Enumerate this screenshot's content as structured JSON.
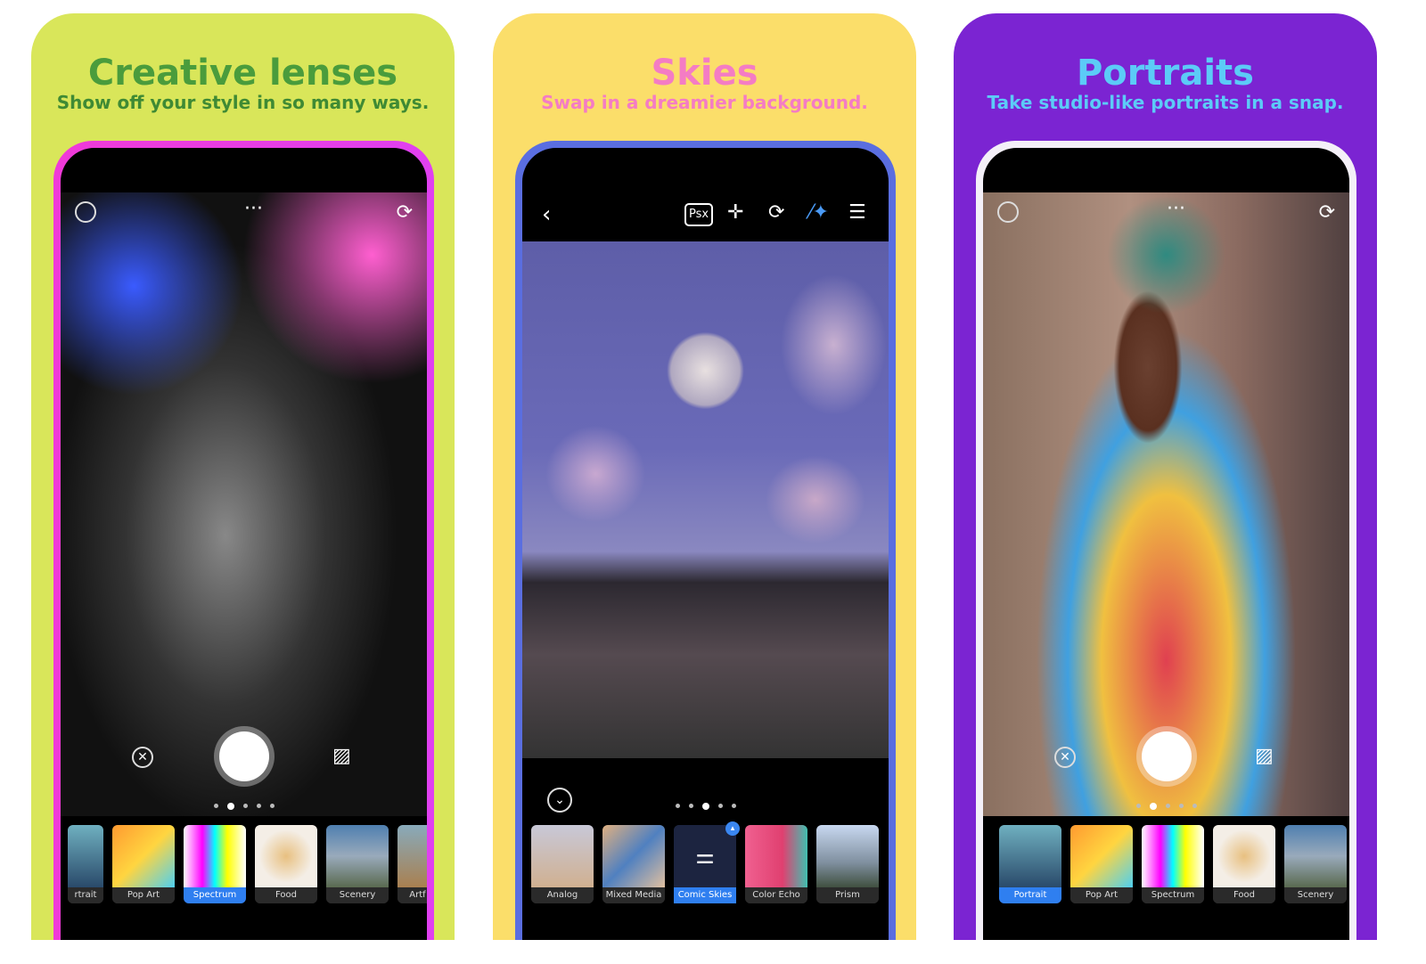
{
  "colors": {
    "panel1_bg": "#d9e65a",
    "panel1_title": "#4a9c3c",
    "panel2_bg": "#fbde6a",
    "panel2_title": "#f47cc4",
    "panel3_bg": "#7b24d2",
    "panel3_title": "#5ccbf7",
    "selected": "#2f7ff0"
  },
  "panels": [
    {
      "title": "Creative lenses",
      "subtitle": "Show off your style in so many ways.",
      "icons": [
        "globe-icon",
        "more-icon",
        "switch-camera-icon",
        "close-circle-icon",
        "gallery-icon"
      ],
      "active_dot": 2,
      "thumbs": [
        {
          "label": "rtrait"
        },
        {
          "label": "Pop Art"
        },
        {
          "label": "Spectrum",
          "selected": true
        },
        {
          "label": "Food"
        },
        {
          "label": "Scenery"
        },
        {
          "label": "Artf"
        }
      ]
    },
    {
      "title": "Skies",
      "subtitle": "Swap in a dreamier background.",
      "icons": [
        "back-icon",
        "psx-icon",
        "move-icon",
        "replay-icon",
        "magic-wand-icon",
        "sliders-icon",
        "chevron-down-circle-icon"
      ],
      "psx_label": "Psx",
      "active_dot": 3,
      "thumbs": [
        {
          "label": "Analog"
        },
        {
          "label": "Mixed Media"
        },
        {
          "label": "Comic Skies",
          "selected": true
        },
        {
          "label": "Color Echo"
        },
        {
          "label": "Prism"
        }
      ]
    },
    {
      "title": "Portraits",
      "subtitle": "Take studio-like portraits in a snap.",
      "icons": [
        "globe-icon",
        "more-icon",
        "switch-camera-icon",
        "close-circle-icon",
        "gallery-icon"
      ],
      "active_dot": 2,
      "thumbs": [
        {
          "label": "Portrait",
          "selected": true
        },
        {
          "label": "Pop Art"
        },
        {
          "label": "Spectrum"
        },
        {
          "label": "Food"
        },
        {
          "label": "Scenery"
        }
      ]
    }
  ]
}
